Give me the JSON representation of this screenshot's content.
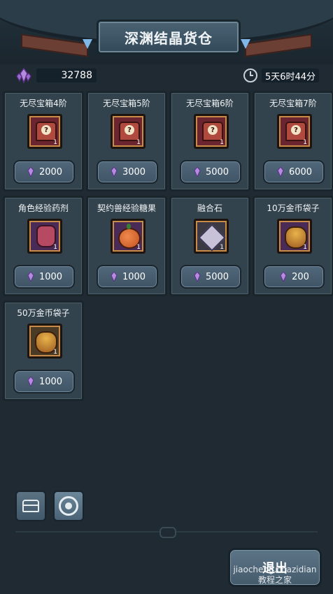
{
  "header": {
    "title": "深渊结晶货仓"
  },
  "status": {
    "crystals": "32788",
    "time_left": "5天6时44分"
  },
  "items": [
    {
      "name": "无尽宝箱4阶",
      "qty": "1",
      "price": "2000",
      "icon": "chest"
    },
    {
      "name": "无尽宝箱5阶",
      "qty": "1",
      "price": "3000",
      "icon": "chest"
    },
    {
      "name": "无尽宝箱6阶",
      "qty": "1",
      "price": "5000",
      "icon": "chest"
    },
    {
      "name": "无尽宝箱7阶",
      "qty": "1",
      "price": "6000",
      "icon": "chest"
    },
    {
      "name": "角色经验药剂",
      "qty": "1",
      "price": "1000",
      "icon": "potion"
    },
    {
      "name": "契约兽经验糖果",
      "qty": "1",
      "price": "1000",
      "icon": "fruit"
    },
    {
      "name": "融合石",
      "qty": "1",
      "price": "5000",
      "icon": "star-stone"
    },
    {
      "name": "10万金币袋子",
      "qty": "1",
      "price": "200",
      "icon": "gold-bag"
    },
    {
      "name": "50万金币袋子",
      "qty": "1",
      "price": "1000",
      "icon": "gold-bag"
    }
  ],
  "chest_question_mark": "?",
  "footer": {
    "exit_label": "退出",
    "watermark_line1": "jiaocheng.chazidian",
    "watermark_line2": "教程之家"
  },
  "colors": {
    "crystal": "#b58be0",
    "background": "#1f2a33",
    "card": "#33434d"
  }
}
